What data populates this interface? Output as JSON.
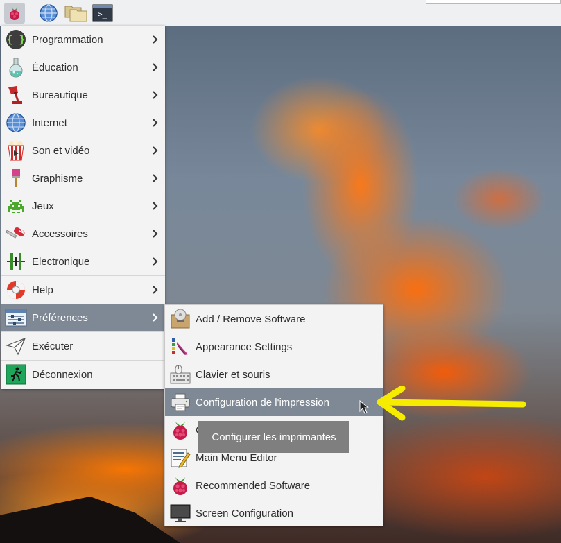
{
  "main_menu": {
    "items": [
      {
        "label": "Programmation",
        "icon": "braces-icon"
      },
      {
        "label": "Éducation",
        "icon": "flask-icon"
      },
      {
        "label": "Bureautique",
        "icon": "desk-lamp-icon"
      },
      {
        "label": "Internet",
        "icon": "globe-icon"
      },
      {
        "label": "Son et vidéo",
        "icon": "popcorn-icon"
      },
      {
        "label": "Graphisme",
        "icon": "paintbrush-icon"
      },
      {
        "label": "Jeux",
        "icon": "space-invader-icon"
      },
      {
        "label": "Accessoires",
        "icon": "swiss-knife-icon"
      },
      {
        "label": "Electronique",
        "icon": "circuit-icon"
      },
      {
        "label": "Help",
        "icon": "lifebuoy-icon"
      },
      {
        "label": "Préférences",
        "icon": "preferences-icon"
      },
      {
        "label": "Exécuter",
        "icon": "paper-plane-icon"
      },
      {
        "label": "Déconnexion",
        "icon": "exit-icon"
      }
    ]
  },
  "sub_menu": {
    "items": [
      {
        "label": "Add / Remove Software",
        "icon": "package-icon"
      },
      {
        "label": "Appearance Settings",
        "icon": "palette-icon"
      },
      {
        "label": "Clavier et souris",
        "icon": "keyboard-mouse-icon"
      },
      {
        "label": "Configuration de l'impression",
        "icon": "printer-icon"
      },
      {
        "label": "C",
        "icon": "raspberry-icon"
      },
      {
        "label": "Main Menu Editor",
        "icon": "menu-editor-icon"
      },
      {
        "label": "Recommended Software",
        "icon": "raspberry-icon"
      },
      {
        "label": "Screen Configuration",
        "icon": "monitor-icon"
      }
    ]
  },
  "tooltip": {
    "text": "Configurer les imprimantes"
  },
  "colors": {
    "selection": "#7f8995",
    "annotation_arrow": "#f5ec00",
    "menu_bg": "#f3f3f3"
  },
  "panel_icons": [
    "raspberry-menu-icon",
    "globe-icon",
    "folders-icon",
    "terminal-icon"
  ],
  "terminal": {
    "prompt": ">_"
  }
}
